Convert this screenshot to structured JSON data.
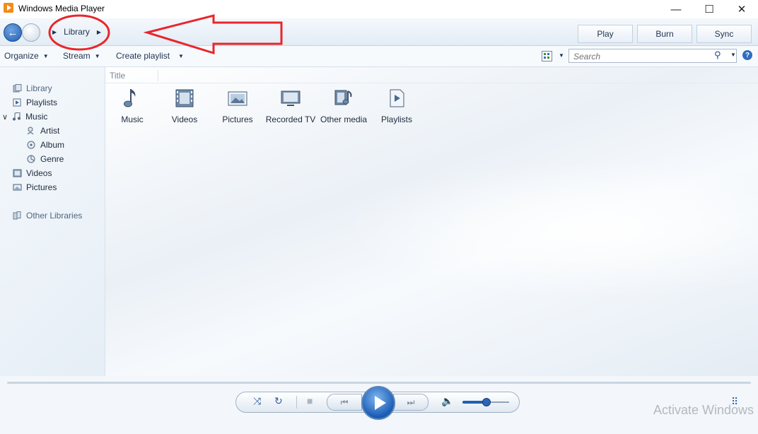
{
  "window": {
    "title": "Windows Media Player",
    "minimize": "—",
    "maximize": "☐",
    "close": "✕"
  },
  "nav": {
    "back_icon": "back-arrow-icon",
    "forward_icon": "forward-arrow-icon",
    "breadcrumb": [
      "Library"
    ]
  },
  "tabs": [
    "Play",
    "Burn",
    "Sync"
  ],
  "toolbar": {
    "organize": "Organize",
    "stream": "Stream",
    "create_playlist": "Create playlist",
    "search_placeholder": "Search"
  },
  "sidebar": {
    "items": [
      {
        "label": "Library",
        "icon": "library-icon",
        "dim": true
      },
      {
        "label": "Playlists",
        "icon": "playlist-icon"
      },
      {
        "label": "Music",
        "icon": "music-note-icon",
        "expanded": true
      },
      {
        "label": "Artist",
        "icon": "artist-icon"
      },
      {
        "label": "Album",
        "icon": "album-icon"
      },
      {
        "label": "Genre",
        "icon": "genre-icon"
      },
      {
        "label": "Videos",
        "icon": "video-icon"
      },
      {
        "label": "Pictures",
        "icon": "picture-icon"
      },
      {
        "label": "Other Libraries",
        "icon": "other-libraries-icon",
        "dim": true
      }
    ]
  },
  "content": {
    "column_header": "Title",
    "tiles": [
      {
        "label": "Music",
        "icon": "music-note-icon"
      },
      {
        "label": "Videos",
        "icon": "film-icon"
      },
      {
        "label": "Pictures",
        "icon": "picture-icon"
      },
      {
        "label": "Recorded TV",
        "icon": "tv-icon"
      },
      {
        "label": "Other media",
        "icon": "other-media-icon"
      },
      {
        "label": "Playlists",
        "icon": "playlist-icon"
      }
    ]
  },
  "player": {
    "shuffle_icon": "shuffle-icon",
    "repeat_icon": "repeat-icon",
    "stop_icon": "stop-icon",
    "prev_icon": "previous-icon",
    "play_icon": "play-icon",
    "next_icon": "next-icon",
    "volume_icon": "speaker-icon",
    "volume_level": 0.5,
    "switch_view_icon": "switch-to-now-playing-icon"
  },
  "watermark": "Activate Windows",
  "annotation": {
    "color": "#e8262b"
  }
}
